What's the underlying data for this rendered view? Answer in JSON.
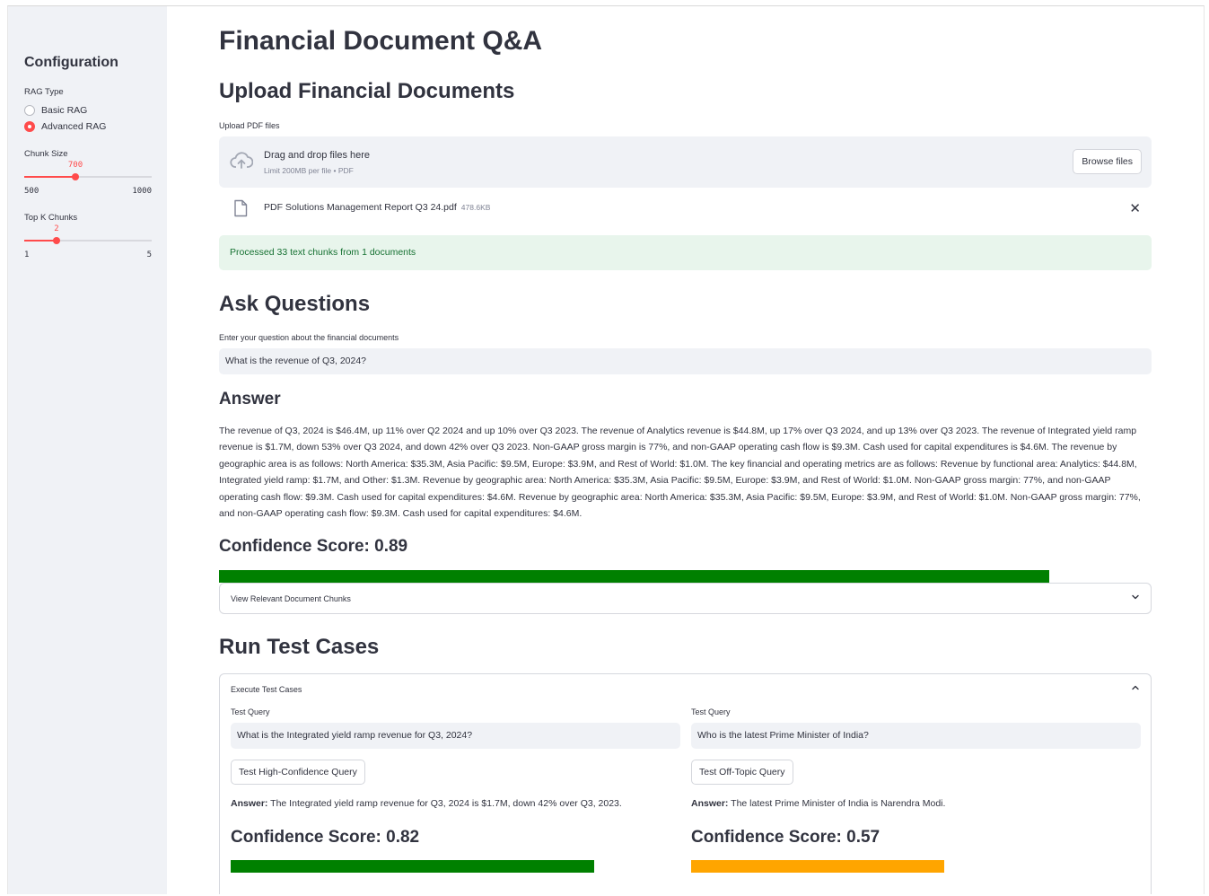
{
  "sidebar": {
    "title": "Configuration",
    "rag_type": {
      "label": "RAG Type",
      "options": [
        "Basic RAG",
        "Advanced RAG"
      ],
      "selected": "Advanced RAG"
    },
    "chunk_size": {
      "label": "Chunk Size",
      "value": "700",
      "min": "500",
      "max": "1000",
      "fraction": 0.4
    },
    "top_k": {
      "label": "Top K Chunks",
      "value": "2",
      "min": "1",
      "max": "5",
      "fraction": 0.25
    }
  },
  "main": {
    "title": "Financial Document Q&A",
    "upload": {
      "heading": "Upload Financial Documents",
      "label": "Upload PDF files",
      "drop_text": "Drag and drop files here",
      "limit_text": "Limit 200MB per file • PDF",
      "browse_label": "Browse files",
      "file_name": "PDF Solutions Management Report Q3 24.pdf",
      "file_size": "478.6KB",
      "success_message": "Processed 33 text chunks from 1 documents"
    },
    "ask": {
      "heading": "Ask Questions",
      "input_label": "Enter your question about the financial documents",
      "input_value": "What is the revenue of Q3, 2024?",
      "answer_heading": "Answer",
      "answer_text": "The revenue of Q3, 2024 is $46.4M, up 11% over Q2 2024 and up 10% over Q3 2023. The revenue of Analytics revenue is $44.8M, up 17% over Q3 2024, and up 13% over Q3 2023. The revenue of Integrated yield ramp revenue is $1.7M, down 53% over Q3 2024, and down 42% over Q3 2023. Non-GAAP gross margin is 77%, and non-GAAP operating cash flow is $9.3M. Cash used for capital expenditures is $4.6M. The revenue by geographic area is as follows: North America: $35.3M, Asia Pacific: $9.5M, Europe: $3.9M, and Rest of World: $1.0M. The key financial and operating metrics are as follows: Revenue by functional area: Analytics: $44.8M, Integrated yield ramp: $1.7M, and Other: $1.3M. Revenue by geographic area: North America: $35.3M, Asia Pacific: $9.5M, Europe: $3.9M, and Rest of World: $1.0M. Non-GAAP gross margin: 77%, and non-GAAP operating cash flow: $9.3M. Cash used for capital expenditures: $4.6M. Revenue by geographic area: North America: $35.3M, Asia Pacific: $9.5M, Europe: $3.9M, and Rest of World: $1.0M. Non-GAAP gross margin: 77%, and non-GAAP operating cash flow: $9.3M. Cash used for capital expenditures: $4.6M.",
      "confidence_label": "Confidence Score: 0.89",
      "confidence": 0.89,
      "bar_color": "#008000",
      "chunks_expander": "View Relevant Document Chunks"
    },
    "tests": {
      "heading": "Run Test Cases",
      "expander_label": "Execute Test Cases",
      "left": {
        "query_label": "Test Query",
        "query_value": "What is the Integrated yield ramp revenue for Q3, 2024?",
        "button_label": "Test High-Confidence Query",
        "answer_prefix": "Answer:",
        "answer_text": "The Integrated yield ramp revenue for Q3, 2024 is $1.7M, down 42% over Q3, 2023.",
        "confidence_label": "Confidence Score: 0.82",
        "confidence": 0.82,
        "bar_color": "#008000"
      },
      "right": {
        "query_label": "Test Query",
        "query_value": "Who is the latest Prime Minister of India?",
        "button_label": "Test Off-Topic Query",
        "answer_prefix": "Answer:",
        "answer_text": "The latest Prime Minister of India is Narendra Modi.",
        "confidence_label": "Confidence Score: 0.57",
        "confidence": 0.57,
        "bar_color": "#ffa500"
      }
    }
  }
}
